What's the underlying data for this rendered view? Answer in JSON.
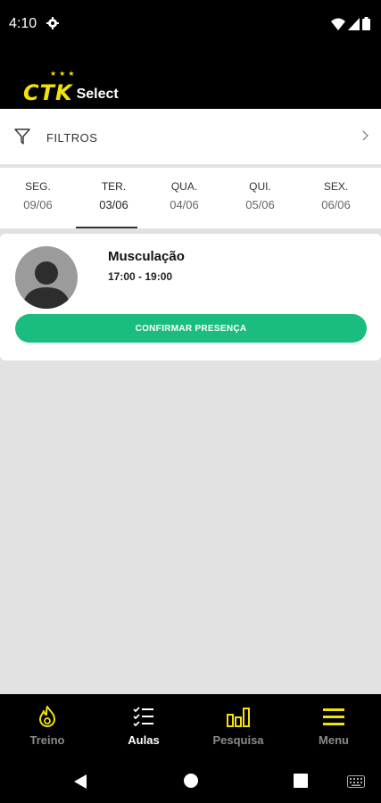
{
  "status_bar": {
    "time": "4:10"
  },
  "header": {
    "logo_text": "CTK",
    "logo_suffix": "Select"
  },
  "filters": {
    "label": "FILTROS"
  },
  "days": [
    {
      "name": "SEG.",
      "date": "09/06"
    },
    {
      "name": "TER.",
      "date": "03/06"
    },
    {
      "name": "QUA.",
      "date": "04/06"
    },
    {
      "name": "QUI.",
      "date": "05/06"
    },
    {
      "name": "SEX.",
      "date": "06/06"
    }
  ],
  "class_card": {
    "name": "Musculação",
    "time": "17:00 - 19:00",
    "confirm_label": "CONFIRMAR PRESENÇA"
  },
  "bottom_nav": [
    {
      "label": "Treino",
      "icon": "flame-icon"
    },
    {
      "label": "Aulas",
      "icon": "checklist-icon"
    },
    {
      "label": "Pesquisa",
      "icon": "bar-chart-icon"
    },
    {
      "label": "Menu",
      "icon": "hamburger-icon"
    }
  ],
  "colors": {
    "accent": "#f3e300",
    "confirm": "#1bbd7e",
    "background": "#e2e2e2"
  }
}
